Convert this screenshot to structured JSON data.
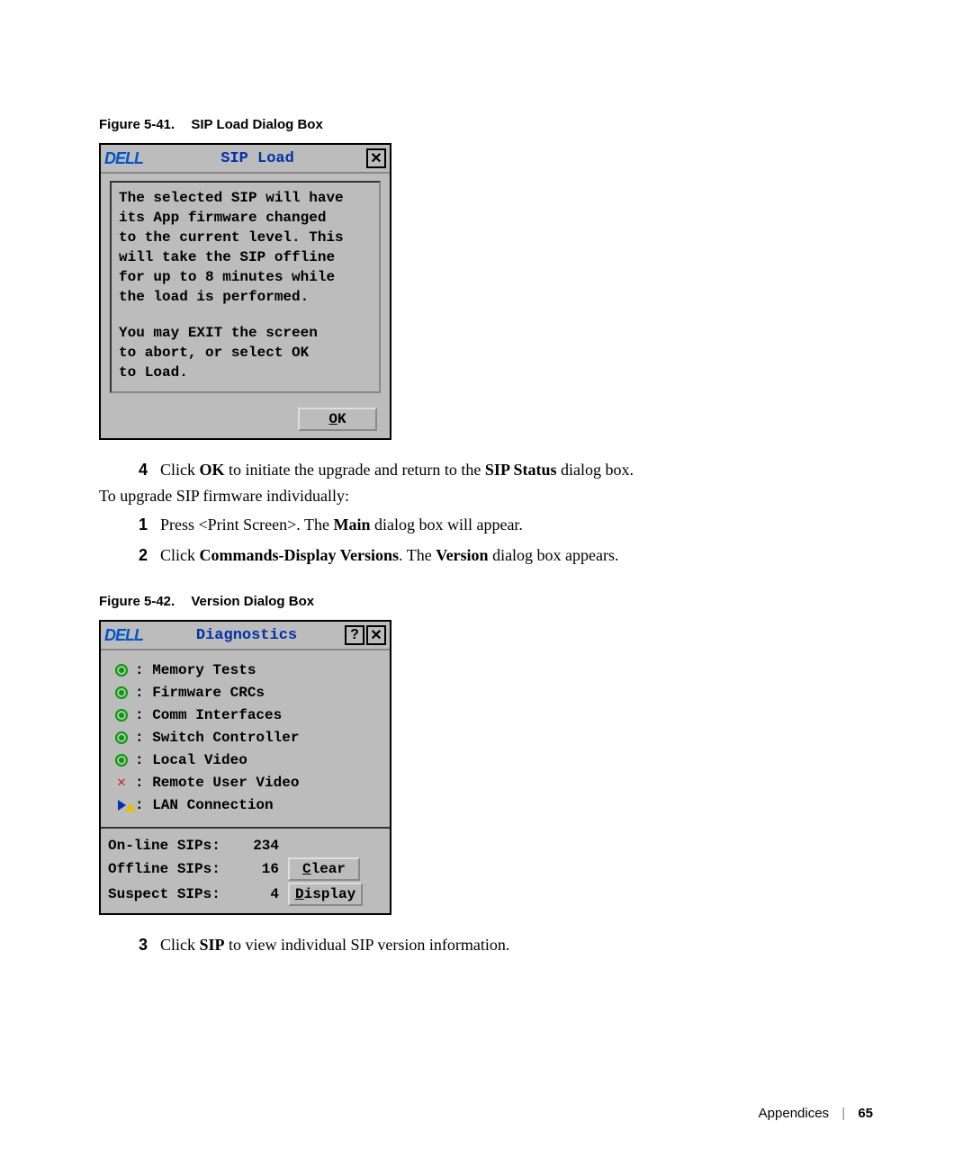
{
  "figure1": {
    "label": "Figure 5-41.",
    "title": "SIP Load Dialog Box"
  },
  "sipload": {
    "logo": "DELL",
    "title": "SIP Load",
    "body_line1": "The selected SIP will have",
    "body_line2": "its App firmware changed",
    "body_line3": "to the current level.  This",
    "body_line4": "will take the SIP offline",
    "body_line5": "for up to 8 minutes while",
    "body_line6": "the load is performed.",
    "body_line7": "You may EXIT the screen",
    "body_line8": "to abort, or select OK",
    "body_line9": "to Load.",
    "ok_prefix": "O",
    "ok_rest": "K"
  },
  "step4": {
    "num": "4",
    "pre": "Click ",
    "bold1": "OK",
    "mid": " to initiate the upgrade and return to the ",
    "bold2": "SIP Status",
    "post": " dialog box."
  },
  "lead": "To upgrade SIP firmware individually:",
  "step1": {
    "num": "1",
    "pre": "Press <Print Screen>. The ",
    "bold1": "Main",
    "post": " dialog box will appear."
  },
  "step2": {
    "num": "2",
    "pre": "Click ",
    "bold1": "Commands-Display Versions",
    "mid": ". The ",
    "bold2": "Version",
    "post": " dialog box appears."
  },
  "figure2": {
    "label": "Figure 5-42.",
    "title": "Version Dialog Box"
  },
  "diag": {
    "logo": "DELL",
    "title": "Diagnostics",
    "items": [
      {
        "icon": "radio",
        "label": ": Memory Tests"
      },
      {
        "icon": "radio",
        "label": ": Firmware CRCs"
      },
      {
        "icon": "radio",
        "label": ": Comm Interfaces"
      },
      {
        "icon": "radio",
        "label": ": Switch Controller"
      },
      {
        "icon": "radio",
        "label": ": Local Video"
      },
      {
        "icon": "x",
        "label": ": Remote User Video"
      },
      {
        "icon": "arrow",
        "label": ": LAN Connection"
      }
    ],
    "stats": {
      "online": {
        "label": "On-line SIPs:",
        "value": "234"
      },
      "offline": {
        "label": "Offline SIPs:",
        "value": "16"
      },
      "suspect": {
        "label": "Suspect SIPs:",
        "value": "4"
      }
    },
    "clear_prefix": "C",
    "clear_rest": "lear",
    "display_prefix": "D",
    "display_rest": "isplay"
  },
  "step3": {
    "num": "3",
    "pre": "Click ",
    "bold1": "SIP",
    "post": " to view individual SIP version information."
  },
  "footer": {
    "section": "Appendices",
    "page": "65"
  }
}
